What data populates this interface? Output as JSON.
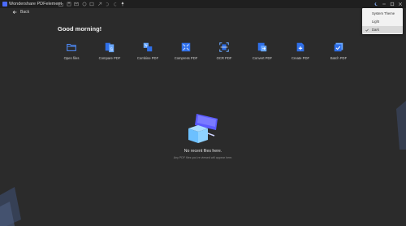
{
  "window": {
    "app_title": "Wondershare PDFelement",
    "toolbar_icons": [
      "folder-icon",
      "save-icon",
      "mail-icon",
      "print-icon",
      "share-icon",
      "arrow-out-icon",
      "undo-icon",
      "redo-icon",
      "pin-icon"
    ],
    "right_icons": [
      "moon-icon",
      "minimize-icon",
      "maximize-icon",
      "close-icon"
    ]
  },
  "nav": {
    "back_label": "Back"
  },
  "home": {
    "greeting": "Good morning!",
    "tools": [
      {
        "label": "Open files",
        "icon": "open-folder-icon"
      },
      {
        "label": "Compare PDF",
        "icon": "compare-pdf-icon"
      },
      {
        "label": "Combine PDF",
        "icon": "combine-pdf-icon"
      },
      {
        "label": "Compress PDF",
        "icon": "compress-pdf-icon"
      },
      {
        "label": "OCR PDF",
        "icon": "ocr-pdf-icon"
      },
      {
        "label": "Convert PDF",
        "icon": "convert-pdf-icon"
      },
      {
        "label": "Create PDF",
        "icon": "create-pdf-icon"
      },
      {
        "label": "Batch PDF",
        "icon": "batch-pdf-icon"
      }
    ],
    "empty_title": "No recent files here.",
    "empty_subtitle": "Any PDF files you've viewed will appear here."
  },
  "theme_menu": {
    "items": [
      {
        "label": "System Theme",
        "selected": false
      },
      {
        "label": "Light",
        "selected": false
      },
      {
        "label": "Dark",
        "selected": true
      }
    ]
  },
  "colors": {
    "background": "#2b2b2b",
    "titlebar": "#1f1f1f",
    "accent": "#4b6bff",
    "icon_blue": "#4f8dff",
    "menu_bg": "#f2f2f2"
  }
}
